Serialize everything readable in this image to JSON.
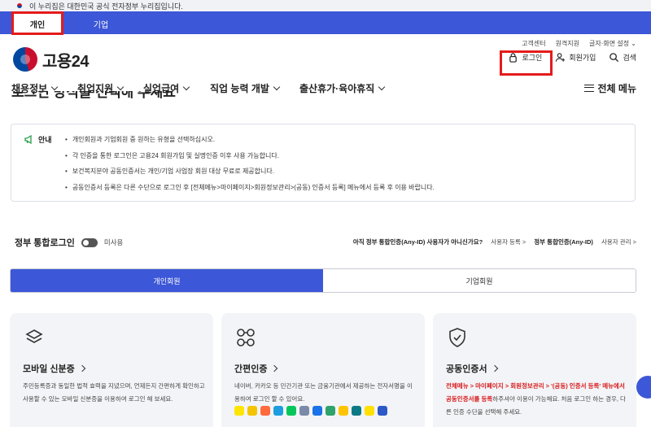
{
  "gov_banner": {
    "text": "이 누리집은 대한민국 공식 전자정부 누리집입니다."
  },
  "type_tabs": [
    {
      "label": "개인",
      "active": true
    },
    {
      "label": "기업",
      "active": false
    }
  ],
  "util_links": [
    "고객센터",
    "원격지원",
    "글자·화면 설정 ⌄"
  ],
  "logo": {
    "text": "고용24"
  },
  "header_actions": {
    "login": "로그인",
    "signup": "회원가입",
    "search": "검색"
  },
  "gnb": {
    "items": [
      "채용정보",
      "취업지원",
      "실업급여",
      "직업 능력 개발",
      "출산휴가·육아휴직"
    ],
    "all_menu": "전체 메뉴"
  },
  "page_title": "로그인 방식을 선택해 주세요",
  "notice": {
    "label": "안내",
    "items": [
      "개인회원과 기업회원 중 원하는 유형을 선택하십시오.",
      "각 인증을 통한 로그인은 고용24 회원가입 및 실명인증 이후 사용 가능합니다.",
      "보건복지분야 공동인증서는 개인/기업 사업장 회원 대상 무료로 제공합니다.",
      "공동인증서 등록은 다른 수단으로 로그인 후 [전체메뉴>마이페이지>회원정보관리>(공동) 인증서 등록] 메뉴에서 등록 후 이용 바랍니다."
    ]
  },
  "integrated_login": {
    "label": "정부 통합로그인",
    "state": "미사용"
  },
  "anyid": {
    "question": "아직 정부 통합인증(Any-ID) 사용자가 아니신가요?",
    "register": "사용자 등록 >",
    "label": "정부 통합인증(Any-ID)",
    "manage": "사용자 관리 >"
  },
  "member_tabs": [
    {
      "label": "개인회원",
      "active": true
    },
    {
      "label": "기업회원",
      "active": false
    }
  ],
  "cards": [
    {
      "title": "모바일 신분증",
      "desc": "주민등록증과 동일한 법적 효력을 지녔으며, 언제든지 간편하게 확인하고 사용할 수 있는 모바일 신분증을 이용하여 로그인 해 보세요."
    },
    {
      "title": "간편인증",
      "desc": "네이버, 카카오 등 민간기관 또는 금융기관에서 제공하는 전자서명을 이용하여 로그인 할 수 있어요."
    },
    {
      "title": "공동인증서",
      "desc_red": "전체메뉴 > 마이페이지 > 회원정보관리 > '(공동) 인증서 등록' 메뉴에서 공동인증서를 등록",
      "desc_rest": "하주셔야 이용이 가능해요. 처음 로그인 하는 경우, 다른 인증 수단을 선택해 주세요."
    }
  ],
  "colors": {
    "primary": "#3c57d7",
    "highlight": "#e51b1b",
    "banner_bg": "#f1f2f6",
    "card_bg": "#f3f4f7"
  }
}
